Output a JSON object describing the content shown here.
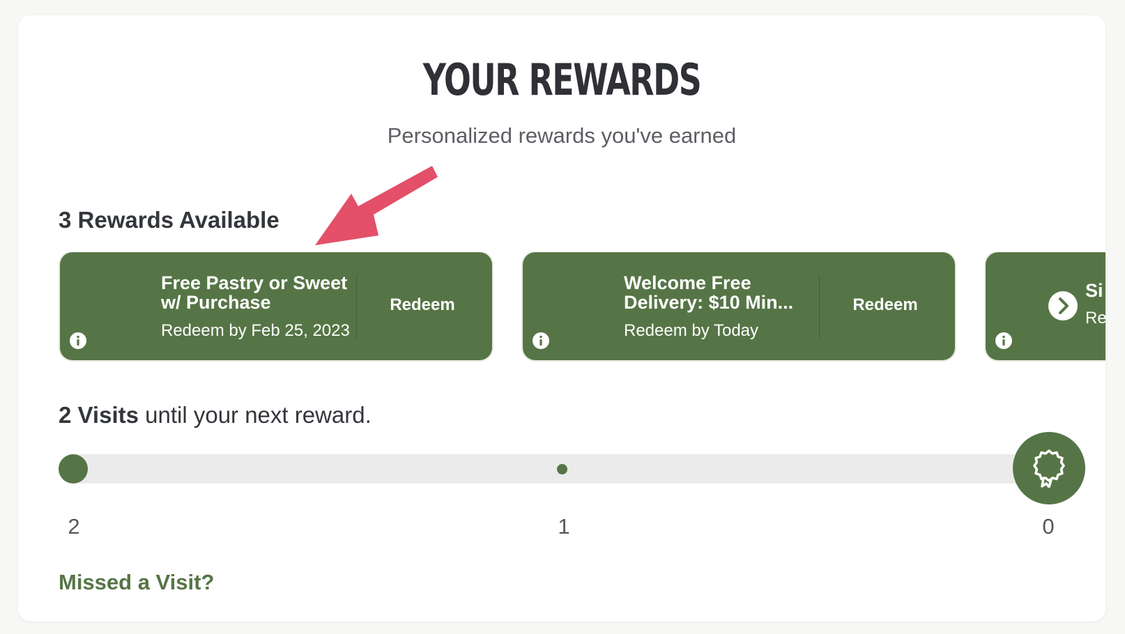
{
  "header": {
    "title": "YOUR REWARDS",
    "subtitle": "Personalized rewards you've earned"
  },
  "rewards": {
    "available_label": "3 Rewards Available",
    "cards": [
      {
        "title": "Free Pastry or Sweet\nw/ Purchase",
        "date": "Redeem by Feb 25, 2023",
        "action": "Redeem",
        "info_icon": "info-icon"
      },
      {
        "title": "Welcome Free\nDelivery: $10 Min...",
        "date": "Redeem by Today",
        "action": "Redeem",
        "info_icon": "info-icon"
      },
      {
        "title_visible": "Si",
        "date_visible": "Re",
        "next_icon": "chevron-right-icon",
        "info_icon": "info-icon"
      }
    ]
  },
  "visits": {
    "count": "2 Visits",
    "text": " until your next reward.",
    "progress_fraction": 0,
    "ticks": [
      "2",
      "1",
      "0"
    ],
    "reward_icon": "reward-badge-icon"
  },
  "links": {
    "missed_visit": "Missed a Visit?"
  },
  "colors": {
    "brand_green": "#567546",
    "annotation_arrow": "#e44f69",
    "track": "#ebebeb",
    "text_dark": "#33363b"
  }
}
